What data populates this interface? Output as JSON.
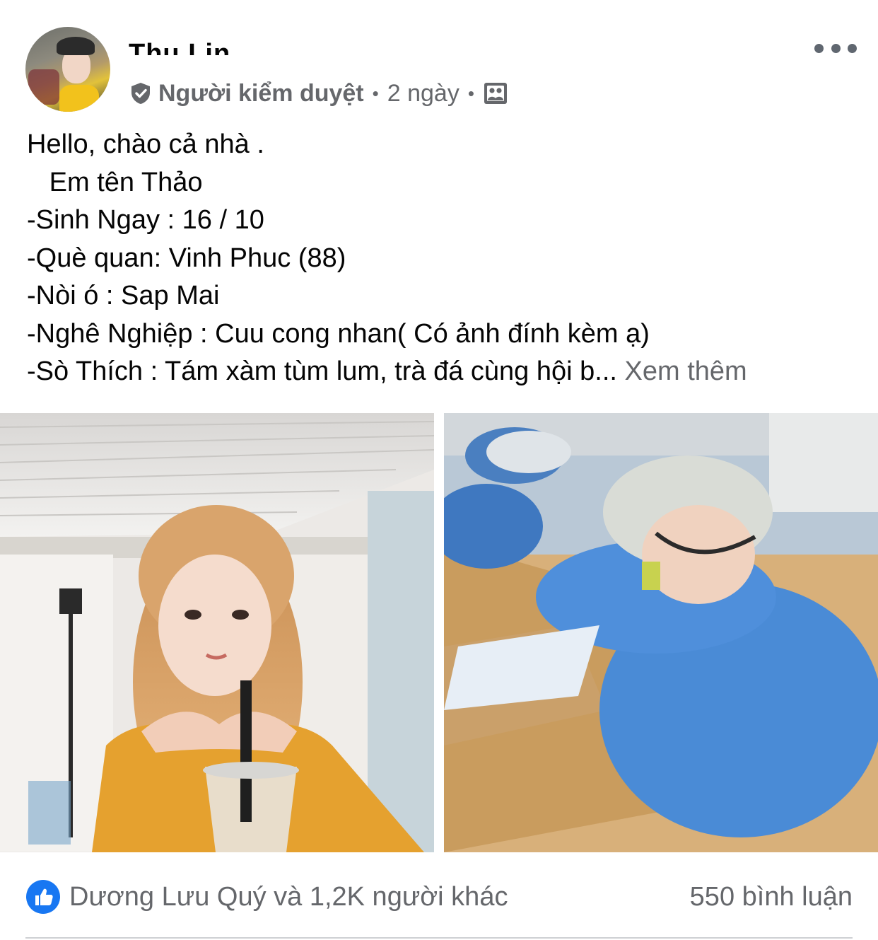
{
  "post": {
    "author": {
      "name": "Thu Lin",
      "role": "Người kiểm duyệt",
      "time": "2 ngày",
      "verified_icon": "shield-check-icon",
      "audience_icon": "group-audience-icon",
      "avatar": "avatar-photo"
    },
    "menu_icon": "more-options-icon",
    "text_lines": [
      "Hello, chào cả nhà .",
      "   Em tên Thảo",
      "-Sinh Ngay : 16 / 10",
      "-Què quan: Vinh Phuc (88)",
      "-Nòi ó : Sap Mai",
      "-Nghê Nghiệp : Cuu cong nhan( Có ảnh đính kèm ạ)"
    ],
    "last_line": "-Sò Thích : Tám xàm tùm lum, trà đá cùng hội b...",
    "see_more": "Xem thêm",
    "photos": [
      "photo-selfie",
      "photo-sleeping-worker"
    ]
  },
  "reactions": {
    "icon": "like-icon",
    "summary": "Dương Lưu Quý và 1,2K người khác",
    "comments": "550 bình luận"
  },
  "colors": {
    "text": "#050505",
    "secondary": "#65676b",
    "like_blue": "#1877f2",
    "divider": "#ced0d4"
  }
}
